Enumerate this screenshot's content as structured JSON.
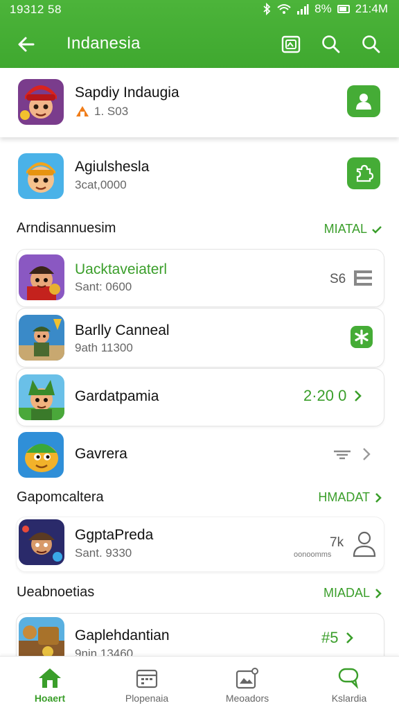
{
  "status": {
    "time_left": "19312 58",
    "battery": "8%",
    "time_right": "21:4M"
  },
  "appbar": {
    "title": "Indanesia"
  },
  "featured": {
    "name": "Sapdiy Indaugia",
    "sub": "1. S03"
  },
  "top_row": {
    "name": "Agiulshesla",
    "sub": "3cat,0000"
  },
  "section1": {
    "title": "Arndisannuesim",
    "link": "MIATAL"
  },
  "section1_rows": [
    {
      "name": "Uacktaveiaterl",
      "sub": "Sant: 0600",
      "meta": "S6"
    },
    {
      "name": "Barlly Canneal",
      "sub": "9ath 11300"
    },
    {
      "name": "Gardatpamia",
      "value": "2·20 0"
    },
    {
      "name": "Gavrera"
    }
  ],
  "section2": {
    "title": "Gapomcaltera",
    "link": "HMADAT"
  },
  "section2_rows": [
    {
      "name": "GgptaPreda",
      "sub": "Sant. 9330",
      "meta_top": "7k",
      "meta_bottom": "oonoomms"
    }
  ],
  "section3": {
    "title": "Ueabnoetias",
    "link": "MIADAL"
  },
  "section3_rows": [
    {
      "name": "Gaplehdantian",
      "sub": "9nin 13460",
      "value": "#5"
    }
  ],
  "nav": [
    {
      "label": "Hoaert",
      "icon": "home-icon",
      "active": true
    },
    {
      "label": "Plopenaia",
      "icon": "calendar-icon",
      "active": false
    },
    {
      "label": "Meoadors",
      "icon": "photo-icon",
      "active": false
    },
    {
      "label": "Kslardia",
      "icon": "chat-icon",
      "active": false
    }
  ],
  "colors": {
    "brand_green": "#45ac36",
    "text_green": "#3a9e2a",
    "white": "#ffffff"
  }
}
